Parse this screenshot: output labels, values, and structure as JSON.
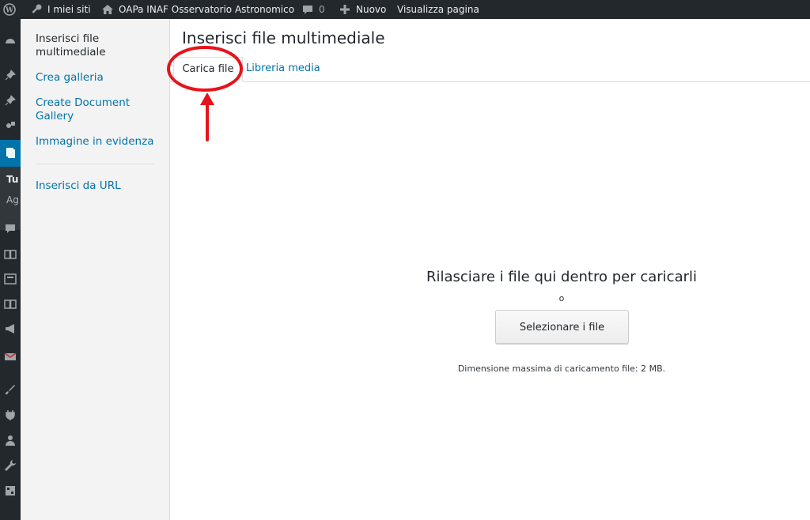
{
  "admin_bar": {
    "my_sites": "I miei siti",
    "site_name": "OAPa INAF Osservatorio Astronomico",
    "comments_count": "0",
    "new_label": "Nuovo",
    "view_page": "Visualizza pagina"
  },
  "admin_menu": {
    "partial_text_1": "Tu",
    "partial_text_2": "Ag"
  },
  "media_menu": {
    "items": [
      {
        "label": "Inserisci file multimediale",
        "active": true
      },
      {
        "label": "Crea galleria"
      },
      {
        "label": "Create Document Gallery"
      },
      {
        "label": "Immagine in evidenza"
      },
      {
        "label": "Inserisci da URL"
      }
    ]
  },
  "content": {
    "title": "Inserisci file multimediale",
    "tabs": [
      {
        "label": "Carica file",
        "active": true
      },
      {
        "label": "Libreria media"
      }
    ],
    "drop_instructions": "Rilasciare i file qui dentro per caricarli",
    "or_text": "o",
    "select_button": "Selezionare i file",
    "max_upload": "Dimensione massima di caricamento file: 2 MB."
  },
  "colors": {
    "admin_dark": "#23282d",
    "link_blue": "#0073aa",
    "annotation_red": "#e8131a"
  }
}
